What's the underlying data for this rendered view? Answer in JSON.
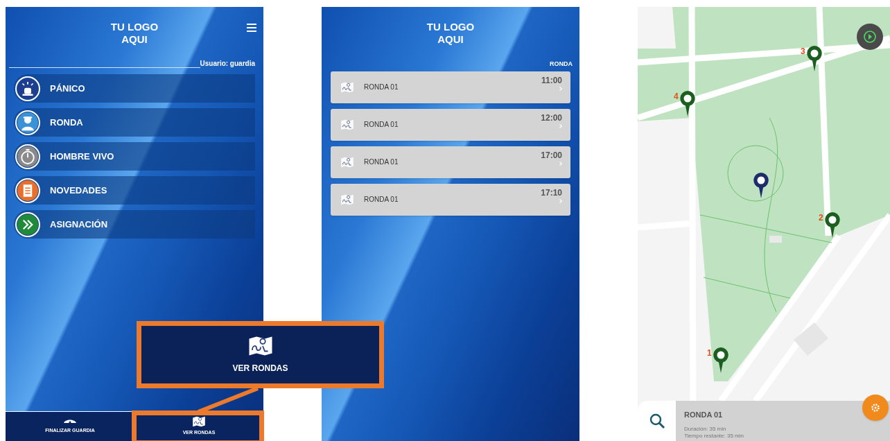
{
  "menu_screen": {
    "logo_lines": [
      "TU LOGO",
      "AQUI"
    ],
    "user_label": "Usuario: guardia",
    "menu_items": [
      {
        "label": "PÁNICO",
        "kind": "siren"
      },
      {
        "label": "RONDA",
        "kind": "guard"
      },
      {
        "label": "HOMBRE VIVO",
        "kind": "timer"
      },
      {
        "label": "NOVEDADES",
        "kind": "notes"
      },
      {
        "label": "ASIGNACIÓN",
        "kind": "forward"
      }
    ],
    "bottom_nav": [
      {
        "label": "FINALIZAR GUARDIA",
        "kind": "cap"
      },
      {
        "label": "VER RONDAS",
        "kind": "map"
      }
    ]
  },
  "callout": {
    "label": "VER RONDAS"
  },
  "rounds_screen": {
    "logo_lines": [
      "TU LOGO",
      "AQUI"
    ],
    "header": "RONDA",
    "rounds": [
      {
        "name": "RONDA 01",
        "time": "11:00"
      },
      {
        "name": "RONDA 01",
        "time": "12:00"
      },
      {
        "name": "RONDA 01",
        "time": "17:00"
      },
      {
        "name": "RONDA 01",
        "time": "17:10"
      }
    ]
  },
  "map_screen": {
    "checkpoints": [
      {
        "number": "1"
      },
      {
        "number": "2"
      },
      {
        "number": "3"
      },
      {
        "number": "4"
      }
    ],
    "panel": {
      "title": "RONDA 01",
      "lines": [
        "Duración: 35 min",
        "Tiempo restante: 35 min"
      ]
    }
  }
}
